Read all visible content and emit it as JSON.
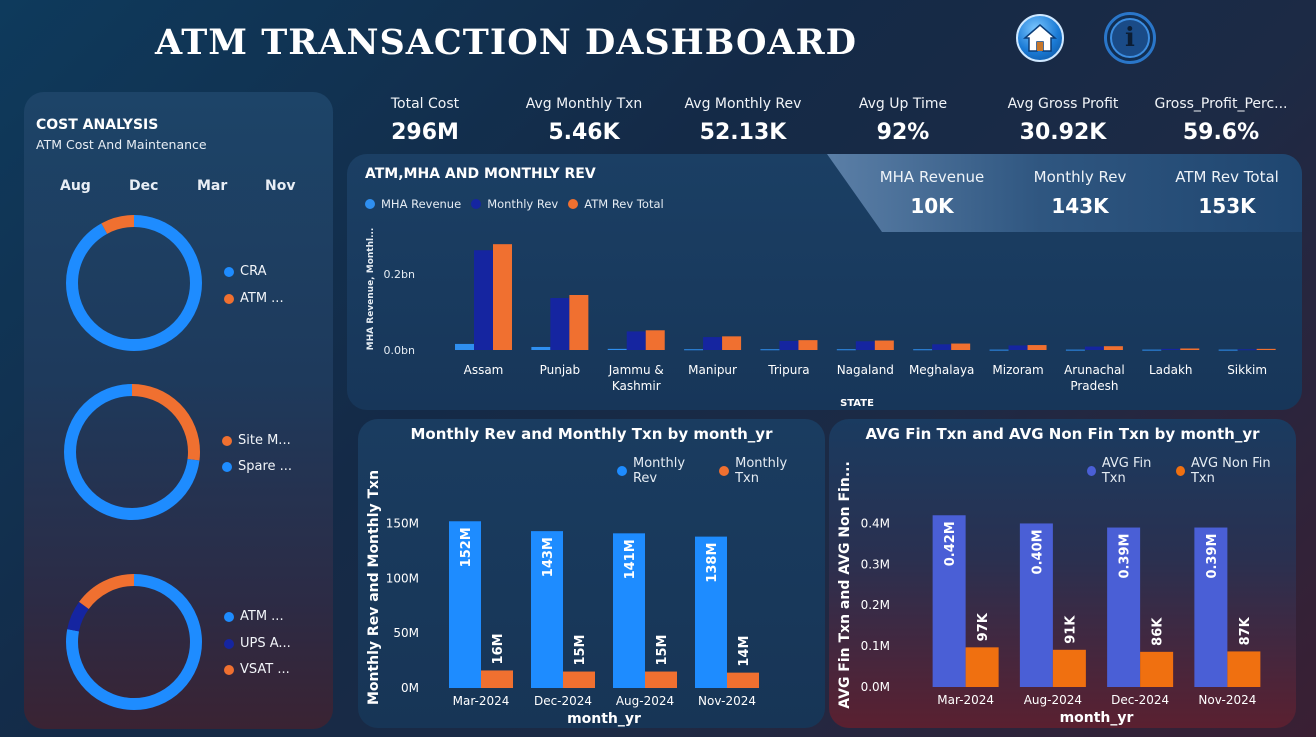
{
  "header": {
    "title": "ATM  TRANSACTION  DASHBOARD"
  },
  "colors": {
    "blue": "#1e8cff",
    "orange": "#f07030",
    "navy": "#1525a0",
    "light_blue": "#2f8ff0",
    "royal": "#4a5fd6"
  },
  "cost_analysis": {
    "title": "COST ANALYSIS",
    "subtitle": "ATM Cost And Maintenance",
    "months": [
      "Aug",
      "Dec",
      "Mar",
      "Nov"
    ],
    "donuts": [
      {
        "legend": [
          {
            "label": "CRA",
            "color": "#1e8cff"
          },
          {
            "label": "ATM ...",
            "color": "#f07030"
          }
        ],
        "segments": [
          {
            "fraction": 0.92,
            "color": "#1e8cff"
          },
          {
            "fraction": 0.08,
            "color": "#f07030"
          }
        ]
      },
      {
        "legend": [
          {
            "label": "Site M...",
            "color": "#f07030"
          },
          {
            "label": "Spare ...",
            "color": "#1e8cff"
          }
        ],
        "segments": [
          {
            "fraction": 0.27,
            "color": "#f07030"
          },
          {
            "fraction": 0.73,
            "color": "#1e8cff"
          }
        ]
      },
      {
        "legend": [
          {
            "label": "ATM ...",
            "color": "#1e8cff"
          },
          {
            "label": "UPS A...",
            "color": "#1525a0"
          },
          {
            "label": "VSAT ...",
            "color": "#f07030"
          }
        ],
        "segments": [
          {
            "fraction": 0.78,
            "color": "#1e8cff"
          },
          {
            "fraction": 0.07,
            "color": "#1525a0"
          },
          {
            "fraction": 0.15,
            "color": "#f07030"
          }
        ]
      }
    ]
  },
  "kpis": [
    {
      "label": "Total Cost",
      "value": "296M"
    },
    {
      "label": "Avg Monthly Txn",
      "value": "5.46K"
    },
    {
      "label": "Avg Monthly Rev",
      "value": "52.13K"
    },
    {
      "label": "Avg Up Time",
      "value": "92%"
    },
    {
      "label": "Avg Gross Profit",
      "value": "30.92K"
    },
    {
      "label": "Gross_Profit_Perc...",
      "value": "59.6%"
    }
  ],
  "rev_panel": {
    "title": "ATM,MHA AND MONTHLY REV",
    "kpis": [
      {
        "label": "MHA Revenue",
        "value": "10K"
      },
      {
        "label": "Monthly Rev",
        "value": "143K"
      },
      {
        "label": "ATM Rev Total",
        "value": "153K"
      }
    ]
  },
  "chart_data": [
    {
      "type": "bar",
      "title": "ATM,MHA AND MONTHLY REV",
      "xlabel": "STATE",
      "ylabel": "MHA Revenue, Monthl...",
      "y_ticks": [
        "0.0bn",
        "0.2bn"
      ],
      "ylim": [
        0,
        0.29
      ],
      "categories": [
        "Assam",
        "Punjab",
        "Jammu & Kashmir",
        "Manipur",
        "Tripura",
        "Nagaland",
        "Meghalaya",
        "Mizoram",
        "Arunachal Pradesh",
        "Ladakh",
        "Sikkim"
      ],
      "series": [
        {
          "name": "MHA Revenue",
          "color": "#2f8ff0",
          "values": [
            0.016,
            0.008,
            0.003,
            0.002,
            0.002,
            0.002,
            0.002,
            0.001,
            0.001,
            0.001,
            0.001
          ]
        },
        {
          "name": "Monthly Rev",
          "color": "#1525a0",
          "values": [
            0.263,
            0.137,
            0.049,
            0.034,
            0.024,
            0.023,
            0.015,
            0.012,
            0.009,
            0.003,
            0.002
          ]
        },
        {
          "name": "ATM Rev Total",
          "color": "#f07030",
          "values": [
            0.279,
            0.145,
            0.052,
            0.036,
            0.026,
            0.025,
            0.017,
            0.013,
            0.01,
            0.004,
            0.003
          ]
        }
      ],
      "legend_position": "top-left"
    },
    {
      "type": "bar",
      "title": "Monthly Rev and Monthly Txn by month_yr",
      "xlabel": "month_yr",
      "ylabel": "Monthly Rev and Monthly Txn",
      "y_ticks": [
        "0M",
        "50M",
        "100M",
        "150M"
      ],
      "ylim": [
        0,
        165
      ],
      "categories": [
        "Mar-2024",
        "Dec-2024",
        "Aug-2024",
        "Nov-2024"
      ],
      "series": [
        {
          "name": "Monthly Rev",
          "color": "#1e8cff",
          "values": [
            152,
            143,
            141,
            138
          ],
          "labels": [
            "152M",
            "143M",
            "141M",
            "138M"
          ]
        },
        {
          "name": "Monthly Txn",
          "color": "#f07030",
          "values": [
            16,
            15,
            15,
            14
          ],
          "labels": [
            "16M",
            "15M",
            "15M",
            "14M"
          ]
        }
      ],
      "legend_position": "top-right"
    },
    {
      "type": "bar",
      "title": "AVG Fin Txn and AVG Non Fin Txn by month_yr",
      "xlabel": "month_yr",
      "ylabel": "AVG Fin Txn and AVG Non Fin...",
      "y_ticks": [
        "0.0M",
        "0.1M",
        "0.2M",
        "0.3M",
        "0.4M"
      ],
      "ylim": [
        0,
        0.45
      ],
      "categories": [
        "Mar-2024",
        "Aug-2024",
        "Dec-2024",
        "Nov-2024"
      ],
      "series": [
        {
          "name": "AVG Fin Txn",
          "color": "#4a5fd6",
          "values": [
            0.42,
            0.4,
            0.39,
            0.39
          ],
          "labels": [
            "0.42M",
            "0.40M",
            "0.39M",
            "0.39M"
          ]
        },
        {
          "name": "AVG Non Fin Txn",
          "color": "#f07010",
          "values": [
            0.097,
            0.091,
            0.086,
            0.087
          ],
          "labels": [
            "97K",
            "91K",
            "86K",
            "87K"
          ]
        }
      ],
      "legend_position": "top-right"
    }
  ]
}
